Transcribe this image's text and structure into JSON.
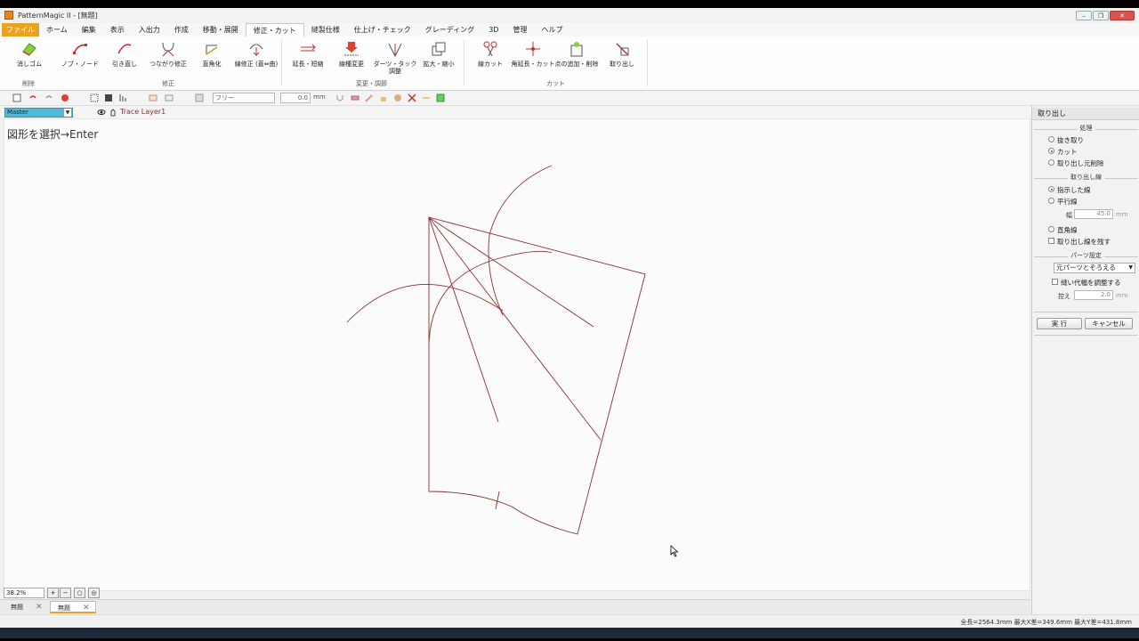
{
  "window": {
    "title": "PatternMagic II - [無題]",
    "controls": [
      "–",
      "❐",
      "✕"
    ]
  },
  "menu": [
    "ファイル",
    "ホーム",
    "編集",
    "表示",
    "入出力",
    "作成",
    "移動・展開",
    "修正・カット",
    "縫製仕様",
    "仕上げ・チェック",
    "グレーディング",
    "3D",
    "管理",
    "ヘルプ"
  ],
  "ribbon": {
    "eraser": "消しゴム",
    "node": "ノブ・ノード",
    "redraw": "引き直し",
    "connect_fix": "つながり修正",
    "straighten": "直角化",
    "line_fix": "線修正 (直⇔曲)",
    "extend": "延長・短縮",
    "line_change": "線種変更",
    "dart_tuck": "ダーツ・タック調整",
    "scale": "拡大・縮小",
    "line_cut": "線カット",
    "corner_cut": "角延長・カット",
    "point_add": "点の追加・削除",
    "extract": "取り出し",
    "groups": {
      "delete": "削除",
      "fix": "修正",
      "change": "変更・調節",
      "cut": "カット"
    }
  },
  "toolbar": {
    "line_type": "フリー",
    "offset": "0.0",
    "unit": "mm"
  },
  "layer": {
    "master": "Master",
    "trace_layer": "Trace Layer1"
  },
  "canvas": {
    "prompt": "図形を選択→Enter",
    "line_color": "#8b2e2e"
  },
  "zoom": {
    "level": "38.2%"
  },
  "tabs": [
    {
      "label": "無題",
      "close": "✕"
    },
    {
      "label": "無題",
      "close": "✕"
    }
  ],
  "status": "全長=2564.3mm 最大X差=349.6mm 最大Y差=431.8mm",
  "panel": {
    "title": "取り出し",
    "process_label": "処理",
    "process_opts": [
      "抜き取り",
      "カット",
      "取り出し元削除"
    ],
    "extract_line_label": "取り出し線",
    "extract_opts": [
      "指示した線",
      "平行線"
    ],
    "width_label": "幅",
    "width_value": "45.0",
    "width_unit": "mm",
    "right_angle": "直角線",
    "keep_line": "取り出し線を残す",
    "parts_label": "パーツ設定",
    "parts_select": "元パーツとそろえる",
    "adjust_seam": "縫い代幅を調整する",
    "margin_label": "控え",
    "margin_value": "2.0",
    "margin_unit": "mm",
    "execute": "実 行",
    "cancel": "キャンセル"
  }
}
